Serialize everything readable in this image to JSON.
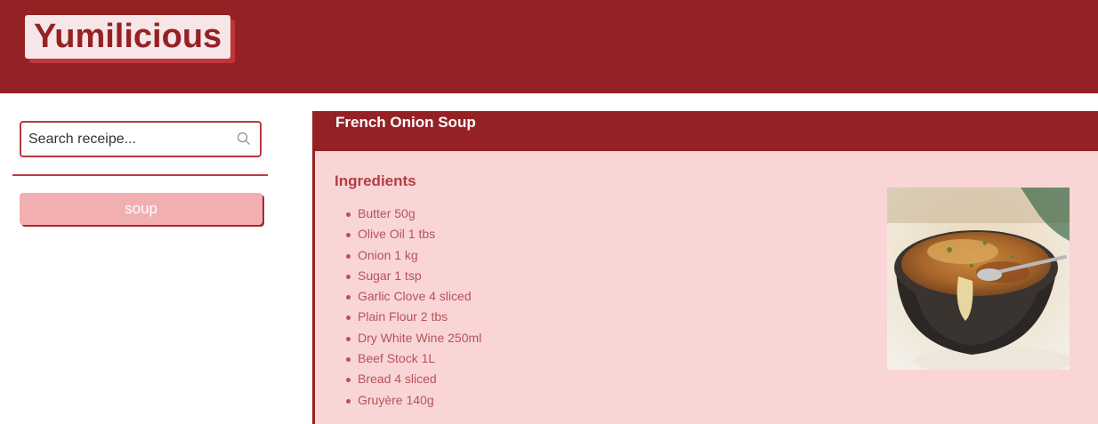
{
  "header": {
    "logo_text": "Yumilicious"
  },
  "sidebar": {
    "search": {
      "placeholder": "Search receipe...",
      "value": ""
    },
    "filter_button_label": "soup"
  },
  "recipe": {
    "title": "French Onion Soup",
    "ingredients_heading": "Ingredients",
    "ingredients": [
      "Butter 50g",
      "Olive Oil 1 tbs",
      "Onion 1 kg",
      "Sugar 1 tsp",
      "Garlic Clove 4 sliced",
      "Plain Flour 2 tbs",
      "Dry White Wine 250ml",
      "Beef Stock 1L",
      "Bread 4 sliced",
      "Gruyère 140g"
    ]
  },
  "colors": {
    "brand": "#962125",
    "panel_background": "#f9d5d6",
    "button": "#f2afb2"
  }
}
